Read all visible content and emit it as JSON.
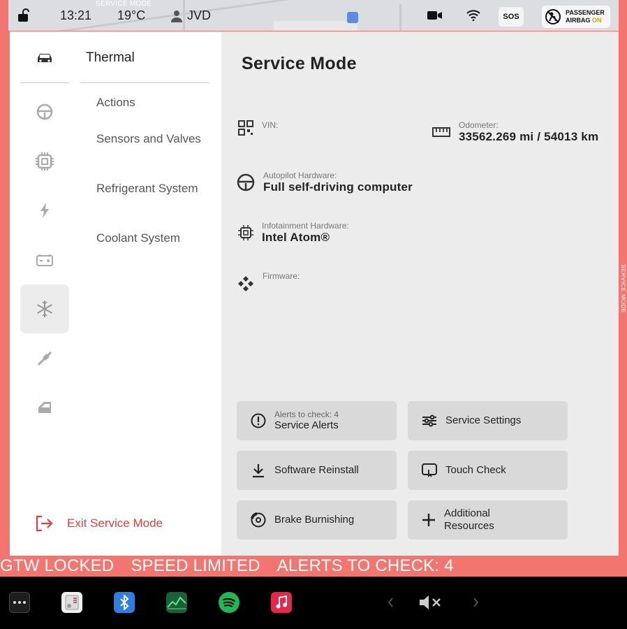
{
  "status_bar": {
    "service_mode_tab": "SERVICE MODE",
    "time": "13:21",
    "temperature": "19°C",
    "user": "JVD",
    "sos": "SOS",
    "airbag_line1": "PASSENGER",
    "airbag_line2": "AIRBAG",
    "airbag_state": "ON"
  },
  "sidebar": {
    "section_title": "Thermal",
    "items": [
      {
        "label": "Actions"
      },
      {
        "label": "Sensors and Valves"
      },
      {
        "label": "Refrigerant System"
      },
      {
        "label": "Coolant System"
      }
    ],
    "exit_label": "Exit Service Mode"
  },
  "main": {
    "title": "Service Mode",
    "vin_label": "VIN:",
    "vin_value": "",
    "odometer_label": "Odometer:",
    "odometer_value": "33562.269 mi / 54013 km",
    "autopilot_label": "Autopilot Hardware:",
    "autopilot_value": "Full self-driving computer",
    "infotainment_label": "Infotainment Hardware:",
    "infotainment_value": "Intel Atom®",
    "firmware_label": "Firmware:",
    "firmware_value": ""
  },
  "buttons": {
    "alerts_sub": "Alerts to check: 4",
    "alerts": "Service Alerts",
    "settings": "Service Settings",
    "reinstall": "Software Reinstall",
    "touch": "Touch Check",
    "brake": "Brake Burnishing",
    "resources_line1": "Additional",
    "resources_line2": "Resources"
  },
  "alert_bar": {
    "items": [
      "GTW LOCKED",
      "SPEED LIMITED",
      "ALERTS TO CHECK: 4"
    ]
  },
  "side_label": "SERVICE MODE",
  "colors": {
    "accent": "#f2766f",
    "exit": "#e0403c"
  }
}
